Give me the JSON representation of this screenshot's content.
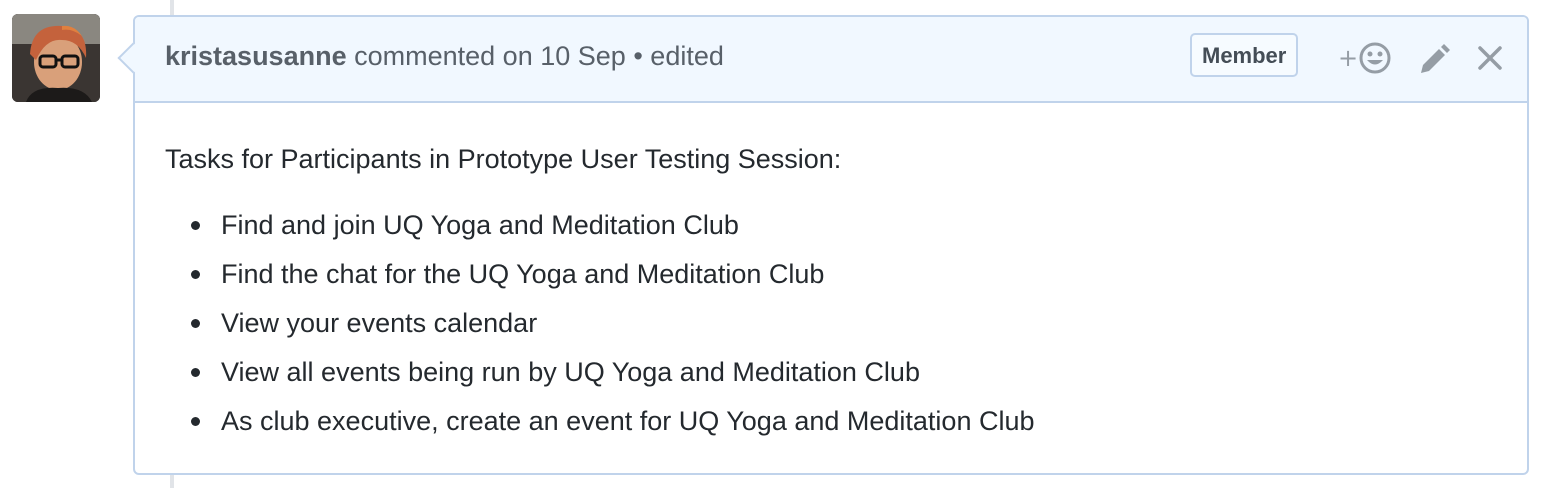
{
  "comment": {
    "author": "kristasusanne",
    "action": "commented on",
    "date": "10 Sep",
    "separator": "•",
    "edited": "edited",
    "badge": "Member",
    "add_reaction_plus": "+",
    "icons": {
      "reaction": "smiley-face-icon",
      "edit": "pencil-icon",
      "delete": "close-icon"
    },
    "body": {
      "intro": "Tasks for Participants in Prototype User Testing Session:",
      "tasks": [
        "Find and join UQ Yoga and Meditation Club",
        "Find the chat for the UQ Yoga and Meditation Club",
        "View your events calendar",
        "View all events being run by UQ Yoga and Meditation Club",
        "As club executive, create an event for UQ Yoga and Meditation Club"
      ]
    }
  },
  "colors": {
    "header_bg": "#f1f8ff",
    "border": "#c0d3eb",
    "muted_text": "#586069",
    "body_text": "#24292e",
    "icon": "#959da5"
  }
}
